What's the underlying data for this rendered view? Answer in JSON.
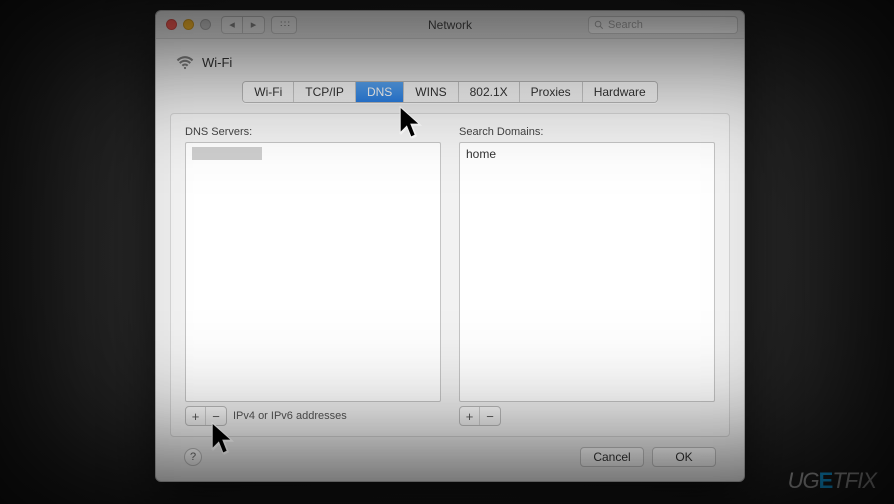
{
  "titlebar": {
    "title": "Network",
    "search_placeholder": "Search"
  },
  "interface": {
    "name": "Wi-Fi"
  },
  "tabs": [
    {
      "label": "Wi-Fi"
    },
    {
      "label": "TCP/IP"
    },
    {
      "label": "DNS"
    },
    {
      "label": "WINS"
    },
    {
      "label": "802.1X"
    },
    {
      "label": "Proxies"
    },
    {
      "label": "Hardware"
    }
  ],
  "active_tab_index": 2,
  "dns": {
    "left_label": "DNS Servers:",
    "right_label": "Search Domains:",
    "footnote": "IPv4 or IPv6 addresses",
    "search_domains": [
      {
        "value": "home"
      }
    ]
  },
  "buttons": {
    "plus": "+",
    "minus": "−",
    "help": "?",
    "cancel": "Cancel",
    "ok": "OK"
  },
  "watermark": "UGETFIX"
}
